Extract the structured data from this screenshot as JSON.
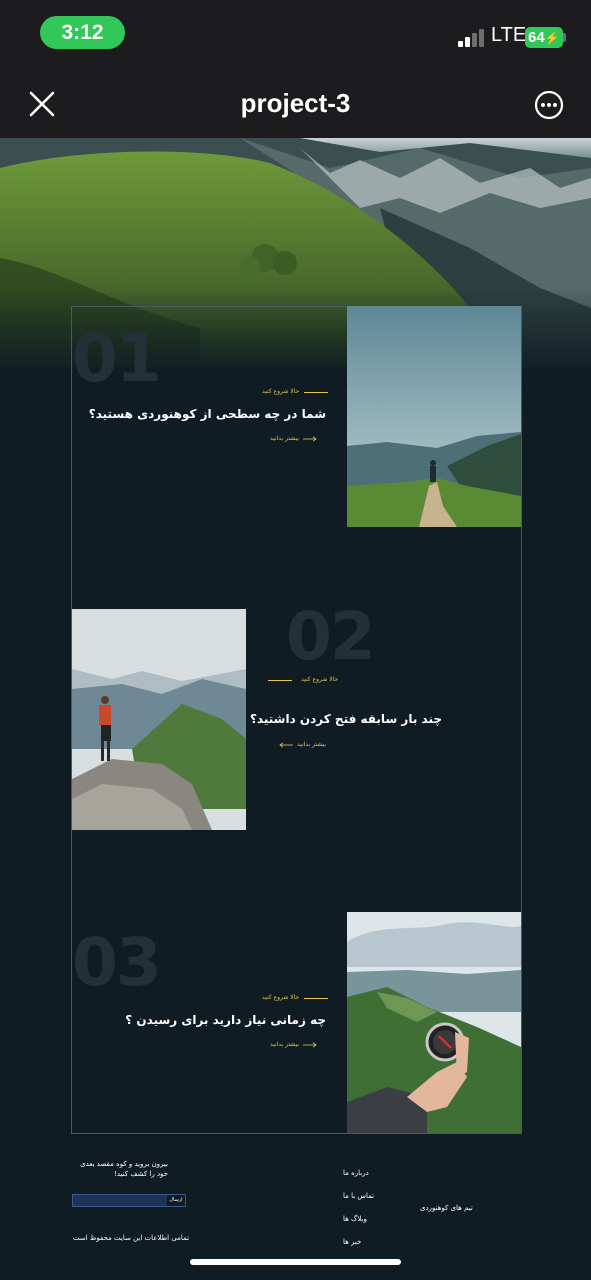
{
  "status_bar": {
    "time": "3:12",
    "network": "LTE",
    "battery": "64"
  },
  "nav": {
    "title": "project-3"
  },
  "sections": [
    {
      "number": "01",
      "kicker": "حالا شروع کنید",
      "headline": "شما در چه سطحی از کوهنوردی هستید؟",
      "link": "بیشتر بدانید"
    },
    {
      "number": "02",
      "kicker": "حالا شروع کنید",
      "headline": "چند بار سابقه فتح کردن داشتید؟",
      "link": "بیشتر بدانید"
    },
    {
      "number": "03",
      "kicker": "حالا شروع کنید",
      "headline": "چه زمانی نیاز دارید برای رسیدن ؟",
      "link": "بیشتر بدانید"
    }
  ],
  "footer": {
    "tagline_line1": "بیرون بروید و کوه مقصد بعدی",
    "tagline_line2": "خود را کشف کنید!",
    "send_label": "ارسال",
    "copyright": "تمامی اطلاعات این سایت محفوظ است",
    "links": [
      "درباره ما",
      "تماس با ما",
      "وبلاگ ها",
      "خبر ها"
    ],
    "brand": "تیم های کوهنوردی"
  },
  "colors": {
    "accent": "#e7c54a",
    "background": "#0f1c24",
    "status_green": "#31c759"
  }
}
